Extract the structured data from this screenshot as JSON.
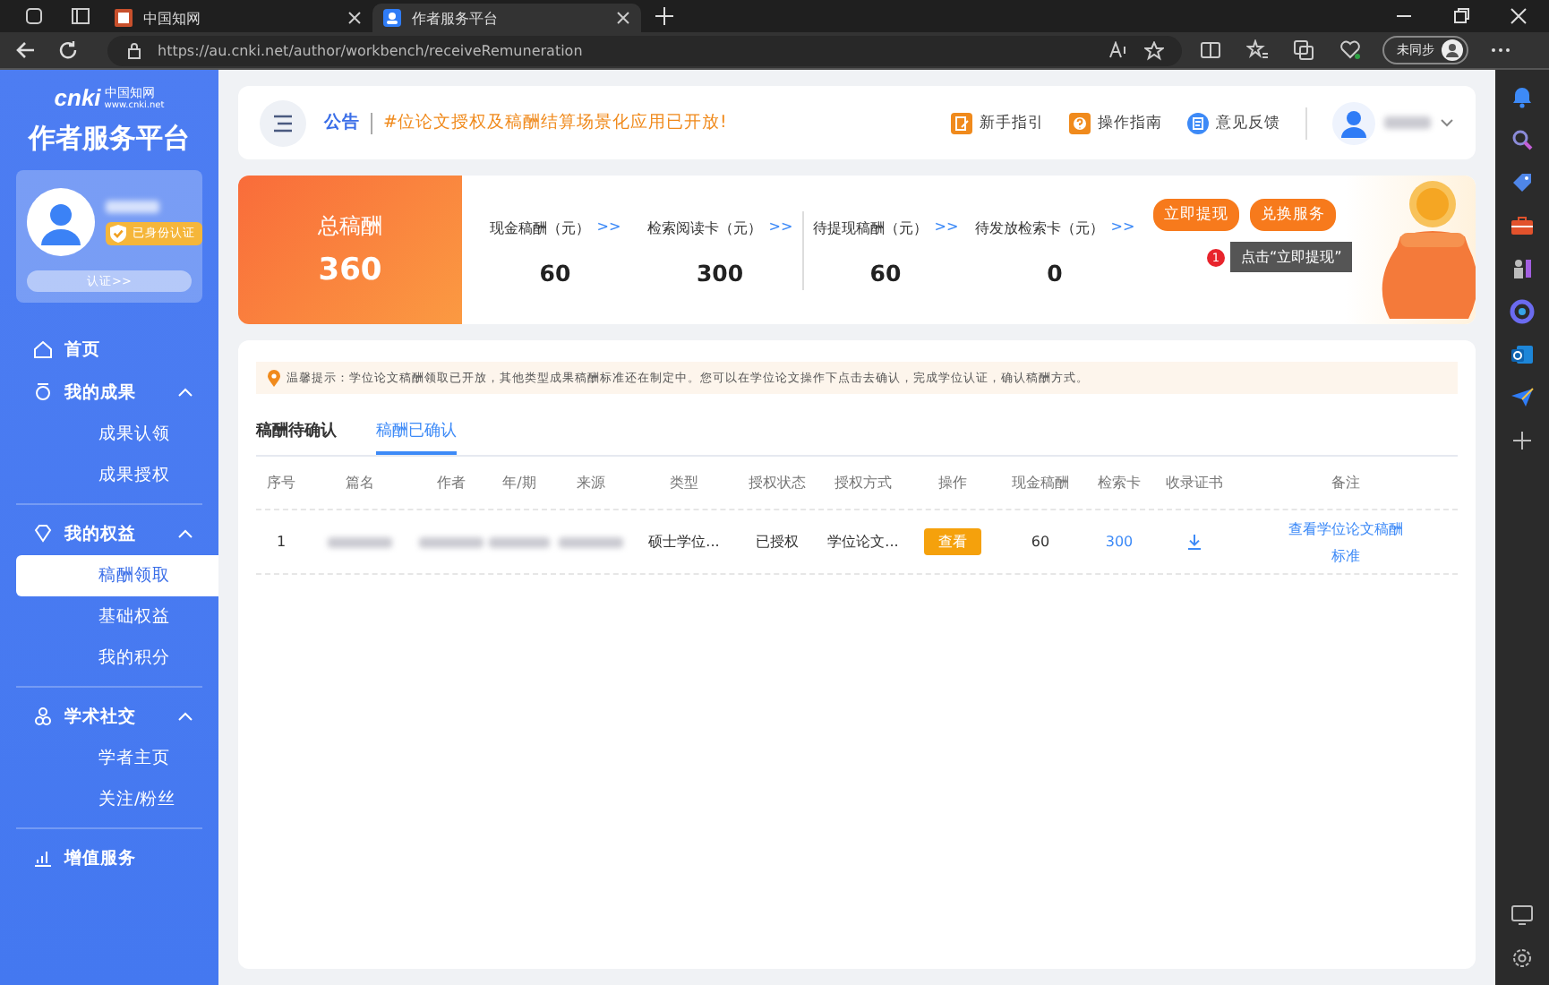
{
  "browser": {
    "tabs": [
      {
        "title": "中国知网",
        "selected": false
      },
      {
        "title": "作者服务平台",
        "selected": true
      }
    ],
    "url": "https://au.cnki.net/author/workbench/receiveRemuneration",
    "profile_label": "未同步"
  },
  "sidebar": {
    "logo": {
      "mark": "cnki",
      "name": "中国知网",
      "site": "www.cnki.net"
    },
    "platform_title": "作者服务平台",
    "verified_badge": "已身份认证",
    "certify_button": "认证>>",
    "nav": [
      {
        "label": "首页"
      },
      {
        "label": "我的成果",
        "expanded": true,
        "children": [
          {
            "label": "成果认领",
            "selected": false
          },
          {
            "label": "成果授权",
            "selected": false
          }
        ]
      },
      {
        "label": "我的权益",
        "expanded": true,
        "children": [
          {
            "label": "稿酬领取",
            "selected": true
          },
          {
            "label": "基础权益",
            "selected": false
          },
          {
            "label": "我的积分",
            "selected": false
          }
        ]
      },
      {
        "label": "学术社交",
        "expanded": true,
        "children": [
          {
            "label": "学者主页",
            "selected": false
          },
          {
            "label": "关注/粉丝",
            "selected": false
          }
        ]
      },
      {
        "label": "增值服务"
      }
    ]
  },
  "header": {
    "notice_label": "公告",
    "notice_text": "#位论文授权及稿酬结算场景化应用已开放!",
    "links": [
      {
        "label": "新手指引"
      },
      {
        "label": "操作指南"
      },
      {
        "label": "意见反馈"
      }
    ]
  },
  "summary": {
    "total_label": "总稿酬",
    "total_value": "360",
    "stats": [
      {
        "label": "现金稿酬（元）",
        "arrow": ">>",
        "value": "60"
      },
      {
        "label": "检索阅读卡（元）",
        "arrow": ">>",
        "value": "300"
      },
      {
        "label": "待提现稿酬（元）",
        "arrow": ">>",
        "value": "60"
      },
      {
        "label": "待发放检索卡（元）",
        "arrow": ">>",
        "value": "0"
      }
    ],
    "buttons": [
      "立即提现",
      "兑换服务"
    ],
    "tooltip": {
      "badge": "1",
      "text": "点击“立即提现”"
    }
  },
  "tip": "温馨提示：学位论文稿酬领取已开放，其他类型成果稿酬标准还在制定中。您可以在学位论文操作下点击去确认，完成学位认证，确认稿酬方式。",
  "tabs": [
    {
      "label": "稿酬待确认",
      "selected": false
    },
    {
      "label": "稿酬已确认",
      "selected": true
    }
  ],
  "table": {
    "columns": [
      "序号",
      "篇名",
      "作者",
      "年/期",
      "来源",
      "类型",
      "授权状态",
      "授权方式",
      "操作",
      "现金稿酬",
      "检索卡",
      "收录证书",
      "备注"
    ],
    "rows": [
      [
        {
          "kind": "text",
          "text": "1"
        },
        {
          "kind": "blurred"
        },
        {
          "kind": "blurred"
        },
        {
          "kind": "blurred"
        },
        {
          "kind": "blurred"
        },
        {
          "kind": "text",
          "text": "硕士学位..."
        },
        {
          "kind": "text",
          "text": "已授权"
        },
        {
          "kind": "text",
          "text": "学位论文..."
        },
        {
          "kind": "button",
          "text": "查看"
        },
        {
          "kind": "text",
          "text": "60"
        },
        {
          "kind": "link",
          "text": "300"
        },
        {
          "kind": "download"
        },
        {
          "kind": "link",
          "text": "查看学位论文稿酬标准"
        }
      ]
    ]
  }
}
